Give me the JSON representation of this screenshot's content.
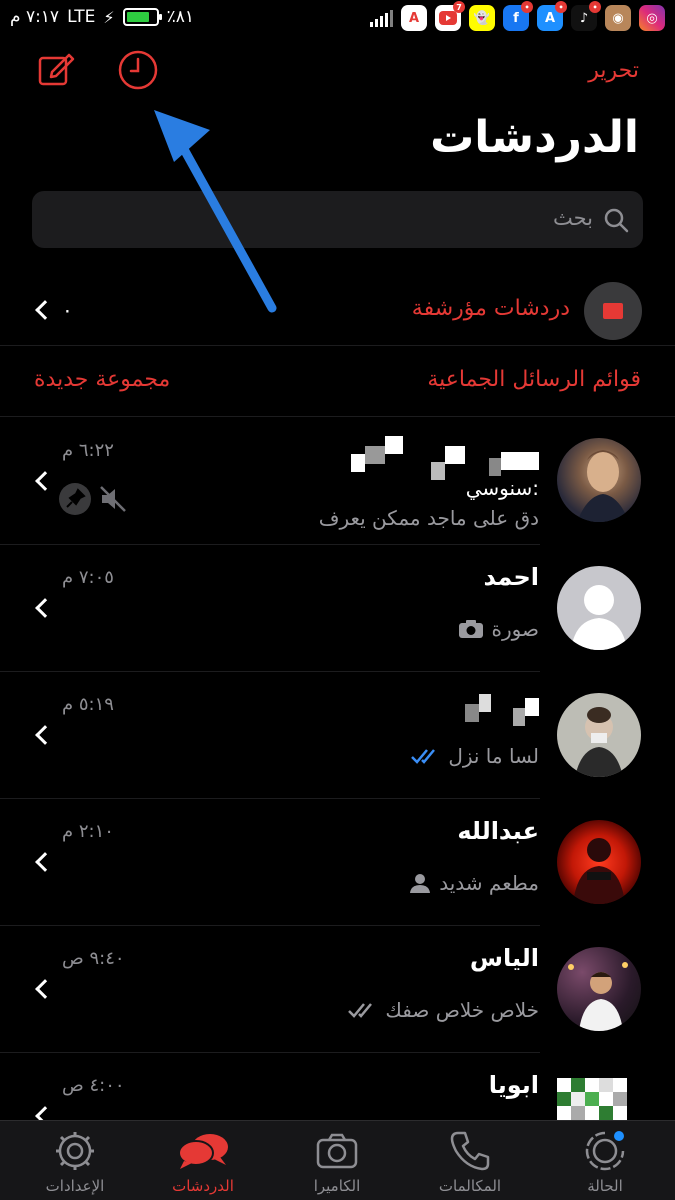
{
  "status_bar": {
    "time": "٧:١٧ م",
    "network": "LTE",
    "battery": "٪٨١",
    "battery_level": 0.81
  },
  "header": {
    "edit_label": "تحرير",
    "title": "الدردشات"
  },
  "search": {
    "placeholder": "بحث"
  },
  "archived": {
    "label": "دردشات مؤرشفة",
    "count": "٠"
  },
  "lists": {
    "broadcast_label": "قوائم الرسائل الجماعية",
    "new_group_label": "مجموعة جديدة"
  },
  "chats": [
    {
      "name": "",
      "time": "٦:٢٢ م",
      "sender": "سنوسي:",
      "message": "دق على ماجد ممكن يعرف",
      "muted": true,
      "pinned": true
    },
    {
      "name": "احمد",
      "time": "٧:٠٥ م",
      "message": "صورة",
      "icon": "camera-icon"
    },
    {
      "name": "",
      "time": "٥:١٩ م",
      "message": "لسا ما نزل",
      "icon": "double-check-icon",
      "read_color": "#3a8ef6"
    },
    {
      "name": "عبدالله",
      "time": "٢:١٠ م",
      "message": "مطعم شديد",
      "icon": "person-icon"
    },
    {
      "name": "الياس",
      "time": "٩:٤٠ ص",
      "message": "خلاص خلاص صفك",
      "icon": "double-check-icon"
    },
    {
      "name": "ابويا",
      "time": "٤:٠٠ ص"
    }
  ],
  "tabs": [
    {
      "label": "الإعدادات",
      "icon": "gear-icon"
    },
    {
      "label": "الدردشات",
      "icon": "chat-bubbles-icon",
      "active": true
    },
    {
      "label": "الكاميرا",
      "icon": "camera-icon"
    },
    {
      "label": "المكالمات",
      "icon": "phone-icon"
    },
    {
      "label": "الحالة",
      "icon": "status-icon"
    }
  ],
  "colors": {
    "accent": "#e53935",
    "background": "#000000",
    "secondary_text": "#8e8e93",
    "annotation_arrow": "#2a7de1"
  }
}
